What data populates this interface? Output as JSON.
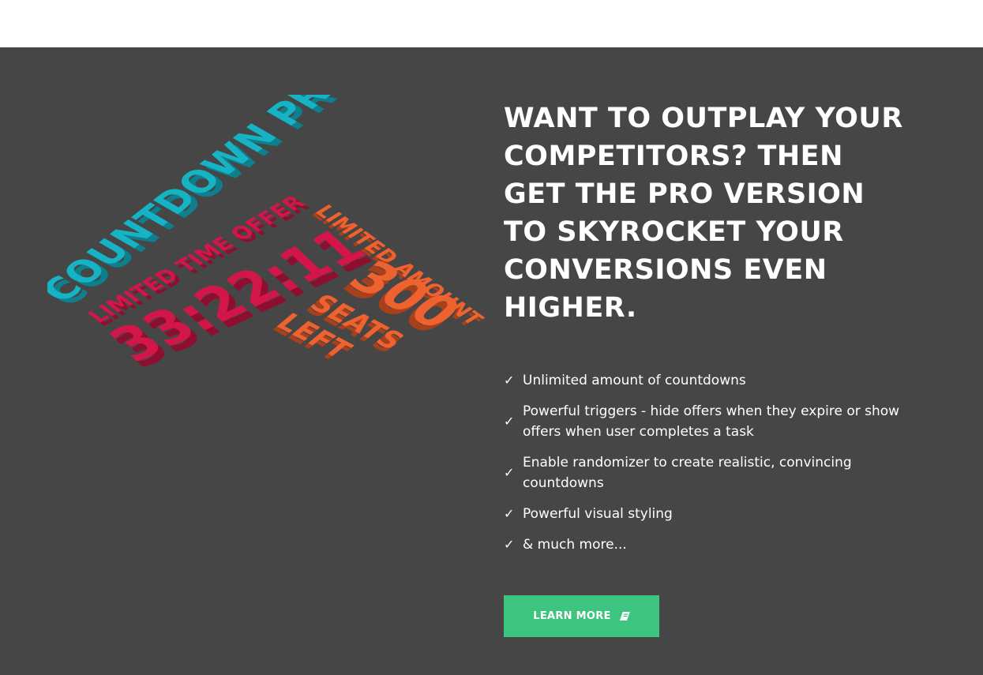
{
  "promo": {
    "illustration": {
      "countdown_pro": "COUNTDOWN PRO",
      "limited_time_offer": "LIMITED TIME OFFER",
      "timer": "33:22:11",
      "limited_amount": "LIMITED AMOUNT",
      "seats_number": "300",
      "seats_word": "SEATS",
      "left_word": "LEFT",
      "colors": {
        "teal": "#16b3c5",
        "crimson": "#d3164a",
        "orange": "#ee6230"
      }
    },
    "headline": "WANT TO OUTPLAY YOUR COMPETITORS? THEN GET THE PRO VERSION TO SKYROCKET YOUR CONVERSIONS EVEN HIGHER.",
    "check_glyph": "✓",
    "features": [
      "Unlimited amount of countdowns",
      "Powerful triggers - hide offers when they expire or show offers when user completes a task",
      "Enable randomizer to create realistic, convincing countdowns",
      "Powerful visual styling",
      "& much more..."
    ],
    "button": {
      "label": "LEARN MORE",
      "icon": "book-icon",
      "color": "#3dc47e"
    },
    "colors": {
      "panel_bg": "#464646",
      "text": "#ffffff"
    }
  }
}
